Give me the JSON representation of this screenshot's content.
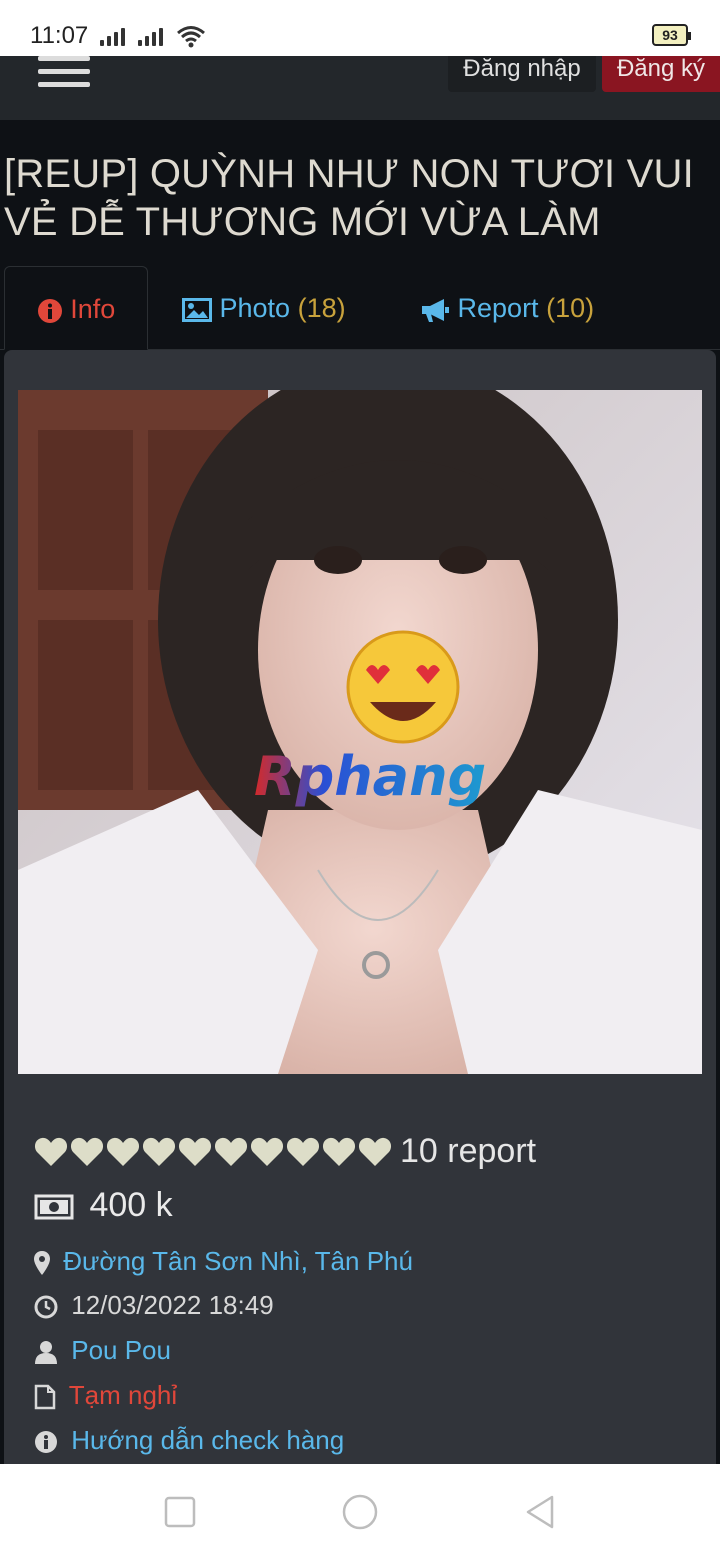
{
  "status_bar": {
    "time": "11:07",
    "battery": "93"
  },
  "header": {
    "login_label": "Đăng nhập",
    "register_label": "Đăng ký"
  },
  "page_title": "[REUP] QUỲNH NHƯ NON TƯƠI VUI VẺ DỄ THƯƠNG MỚI VỪA LÀM",
  "tabs": [
    {
      "label": "Info",
      "count": ""
    },
    {
      "label": "Photo",
      "count": "(18)"
    },
    {
      "label": "Report",
      "count": "(10)"
    }
  ],
  "photo": {
    "watermark": "Rphang"
  },
  "details": {
    "rating_hearts": 10,
    "report_count": "10 report",
    "price": "400 k",
    "location": "Đường Tân Sơn Nhì, Tân Phú",
    "datetime": "12/03/2022 18:49",
    "author": "Pou Pou",
    "status": "Tạm nghỉ",
    "guide_link": "Hướng dẫn check hàng"
  },
  "colors": {
    "link": "#5ab8ea",
    "danger": "#e0473a",
    "count": "#c8a23c",
    "register_bg": "#8a1521"
  }
}
